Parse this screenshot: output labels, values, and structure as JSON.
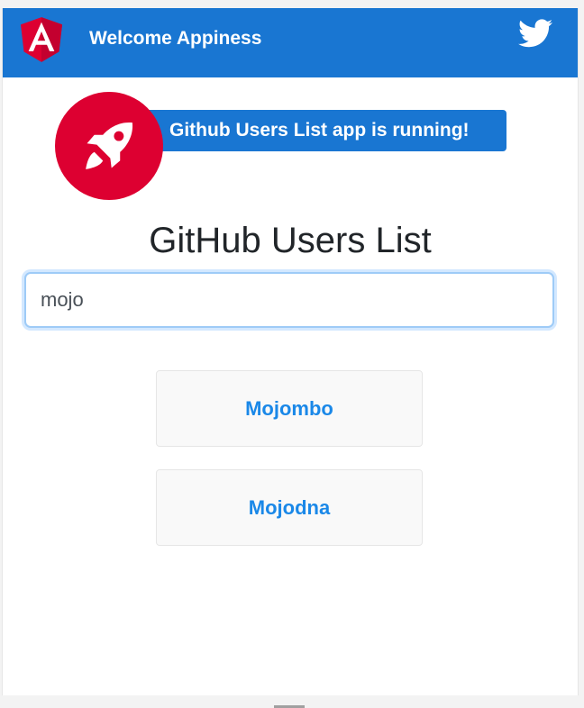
{
  "toolbar": {
    "title": "Welcome Appiness",
    "logo_icon": "angular-logo-icon",
    "social_icon": "twitter-icon",
    "color": "#1976d2"
  },
  "banner": {
    "text": "Github Users List app is running!",
    "icon": "rocket-icon",
    "circle_color": "#dd0031"
  },
  "page": {
    "title": "GitHub Users List"
  },
  "search": {
    "value": "mojo"
  },
  "users": [
    {
      "name": "Mojombo"
    },
    {
      "name": "Mojodna"
    }
  ]
}
